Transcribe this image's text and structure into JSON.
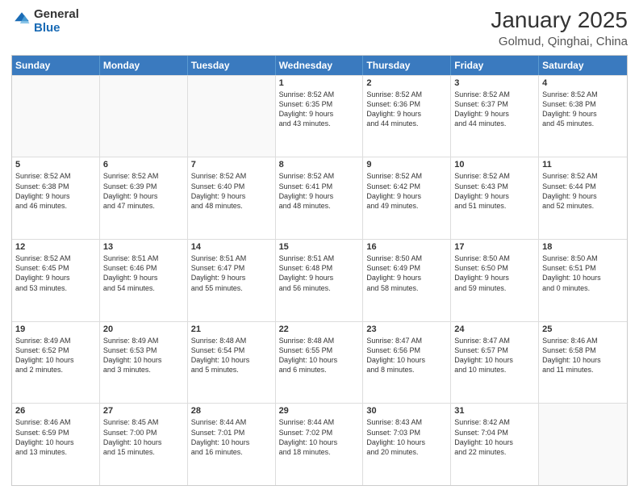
{
  "header": {
    "logo_general": "General",
    "logo_blue": "Blue",
    "month_title": "January 2025",
    "location": "Golmud, Qinghai, China"
  },
  "days_of_week": [
    "Sunday",
    "Monday",
    "Tuesday",
    "Wednesday",
    "Thursday",
    "Friday",
    "Saturday"
  ],
  "weeks": [
    [
      {
        "day": "",
        "info": ""
      },
      {
        "day": "",
        "info": ""
      },
      {
        "day": "",
        "info": ""
      },
      {
        "day": "1",
        "info": "Sunrise: 8:52 AM\nSunset: 6:35 PM\nDaylight: 9 hours\nand 43 minutes."
      },
      {
        "day": "2",
        "info": "Sunrise: 8:52 AM\nSunset: 6:36 PM\nDaylight: 9 hours\nand 44 minutes."
      },
      {
        "day": "3",
        "info": "Sunrise: 8:52 AM\nSunset: 6:37 PM\nDaylight: 9 hours\nand 44 minutes."
      },
      {
        "day": "4",
        "info": "Sunrise: 8:52 AM\nSunset: 6:38 PM\nDaylight: 9 hours\nand 45 minutes."
      }
    ],
    [
      {
        "day": "5",
        "info": "Sunrise: 8:52 AM\nSunset: 6:38 PM\nDaylight: 9 hours\nand 46 minutes."
      },
      {
        "day": "6",
        "info": "Sunrise: 8:52 AM\nSunset: 6:39 PM\nDaylight: 9 hours\nand 47 minutes."
      },
      {
        "day": "7",
        "info": "Sunrise: 8:52 AM\nSunset: 6:40 PM\nDaylight: 9 hours\nand 48 minutes."
      },
      {
        "day": "8",
        "info": "Sunrise: 8:52 AM\nSunset: 6:41 PM\nDaylight: 9 hours\nand 48 minutes."
      },
      {
        "day": "9",
        "info": "Sunrise: 8:52 AM\nSunset: 6:42 PM\nDaylight: 9 hours\nand 49 minutes."
      },
      {
        "day": "10",
        "info": "Sunrise: 8:52 AM\nSunset: 6:43 PM\nDaylight: 9 hours\nand 51 minutes."
      },
      {
        "day": "11",
        "info": "Sunrise: 8:52 AM\nSunset: 6:44 PM\nDaylight: 9 hours\nand 52 minutes."
      }
    ],
    [
      {
        "day": "12",
        "info": "Sunrise: 8:52 AM\nSunset: 6:45 PM\nDaylight: 9 hours\nand 53 minutes."
      },
      {
        "day": "13",
        "info": "Sunrise: 8:51 AM\nSunset: 6:46 PM\nDaylight: 9 hours\nand 54 minutes."
      },
      {
        "day": "14",
        "info": "Sunrise: 8:51 AM\nSunset: 6:47 PM\nDaylight: 9 hours\nand 55 minutes."
      },
      {
        "day": "15",
        "info": "Sunrise: 8:51 AM\nSunset: 6:48 PM\nDaylight: 9 hours\nand 56 minutes."
      },
      {
        "day": "16",
        "info": "Sunrise: 8:50 AM\nSunset: 6:49 PM\nDaylight: 9 hours\nand 58 minutes."
      },
      {
        "day": "17",
        "info": "Sunrise: 8:50 AM\nSunset: 6:50 PM\nDaylight: 9 hours\nand 59 minutes."
      },
      {
        "day": "18",
        "info": "Sunrise: 8:50 AM\nSunset: 6:51 PM\nDaylight: 10 hours\nand 0 minutes."
      }
    ],
    [
      {
        "day": "19",
        "info": "Sunrise: 8:49 AM\nSunset: 6:52 PM\nDaylight: 10 hours\nand 2 minutes."
      },
      {
        "day": "20",
        "info": "Sunrise: 8:49 AM\nSunset: 6:53 PM\nDaylight: 10 hours\nand 3 minutes."
      },
      {
        "day": "21",
        "info": "Sunrise: 8:48 AM\nSunset: 6:54 PM\nDaylight: 10 hours\nand 5 minutes."
      },
      {
        "day": "22",
        "info": "Sunrise: 8:48 AM\nSunset: 6:55 PM\nDaylight: 10 hours\nand 6 minutes."
      },
      {
        "day": "23",
        "info": "Sunrise: 8:47 AM\nSunset: 6:56 PM\nDaylight: 10 hours\nand 8 minutes."
      },
      {
        "day": "24",
        "info": "Sunrise: 8:47 AM\nSunset: 6:57 PM\nDaylight: 10 hours\nand 10 minutes."
      },
      {
        "day": "25",
        "info": "Sunrise: 8:46 AM\nSunset: 6:58 PM\nDaylight: 10 hours\nand 11 minutes."
      }
    ],
    [
      {
        "day": "26",
        "info": "Sunrise: 8:46 AM\nSunset: 6:59 PM\nDaylight: 10 hours\nand 13 minutes."
      },
      {
        "day": "27",
        "info": "Sunrise: 8:45 AM\nSunset: 7:00 PM\nDaylight: 10 hours\nand 15 minutes."
      },
      {
        "day": "28",
        "info": "Sunrise: 8:44 AM\nSunset: 7:01 PM\nDaylight: 10 hours\nand 16 minutes."
      },
      {
        "day": "29",
        "info": "Sunrise: 8:44 AM\nSunset: 7:02 PM\nDaylight: 10 hours\nand 18 minutes."
      },
      {
        "day": "30",
        "info": "Sunrise: 8:43 AM\nSunset: 7:03 PM\nDaylight: 10 hours\nand 20 minutes."
      },
      {
        "day": "31",
        "info": "Sunrise: 8:42 AM\nSunset: 7:04 PM\nDaylight: 10 hours\nand 22 minutes."
      },
      {
        "day": "",
        "info": ""
      }
    ]
  ]
}
